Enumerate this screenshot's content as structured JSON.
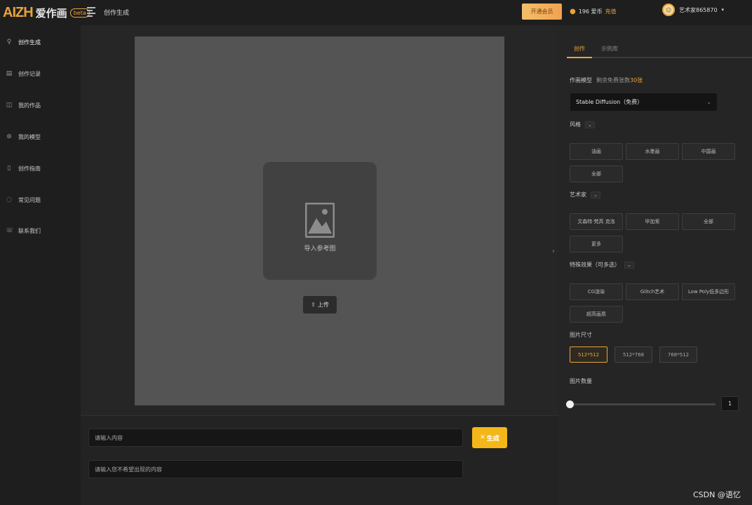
{
  "app": {
    "logo_mark": "AIZH",
    "logo_name": "爱作画",
    "logo_badge": "beta"
  },
  "header": {
    "title": "创作生成",
    "vip_button": "开通会员",
    "coins_text": "196 爱币",
    "recharge": "充值",
    "username": "艺术家865870"
  },
  "sidebar": {
    "items": [
      {
        "label": "创作生成",
        "icon": "bulb-icon",
        "glyph": "♀"
      },
      {
        "label": "创作记录",
        "icon": "record-icon",
        "glyph": "▤"
      },
      {
        "label": "我的作品",
        "icon": "gallery-icon",
        "glyph": "◫"
      },
      {
        "label": "我的模型",
        "icon": "model-icon",
        "glyph": "⊛"
      },
      {
        "label": "创作指南",
        "icon": "guide-icon",
        "glyph": "▯"
      },
      {
        "label": "常见问题",
        "icon": "question-icon",
        "glyph": "◌"
      },
      {
        "label": "联系我们",
        "icon": "contact-icon",
        "glyph": "☏"
      }
    ]
  },
  "canvas": {
    "ref_label": "导入参考图",
    "upload_label": "上传"
  },
  "prompt": {
    "placeholder": "请输入内容",
    "negative_placeholder": "请输入您不希望出现的内容",
    "generate_label": "生成"
  },
  "panel": {
    "tabs": [
      "创作",
      "示例库"
    ],
    "model_label": "作画模型",
    "model_hint": "剩余免费张数",
    "model_hint_count": "30张",
    "model_value": "Stable Diffusion（免费）",
    "style_label": "风格",
    "styles": [
      "油画",
      "水墨画",
      "中国画",
      "全部"
    ],
    "artist_label": "艺术家",
    "artists": [
      "文森特·梵高 克洛",
      "毕加索",
      "全部",
      "更多"
    ],
    "special_label": "特殊效果（可多选）",
    "specials": [
      "CG渲染",
      "Glitch艺术",
      "Low Poly低多边形",
      "超高画质"
    ],
    "size_label": "图片尺寸",
    "sizes": [
      "512*512",
      "512*768",
      "768*512"
    ],
    "selected_size": "512*512",
    "count_label": "图片数量",
    "count_value": "1"
  },
  "watermark": "CSDN @语忆",
  "colors": {
    "accent": "#e9a33a",
    "generate": "#f4b71a"
  }
}
